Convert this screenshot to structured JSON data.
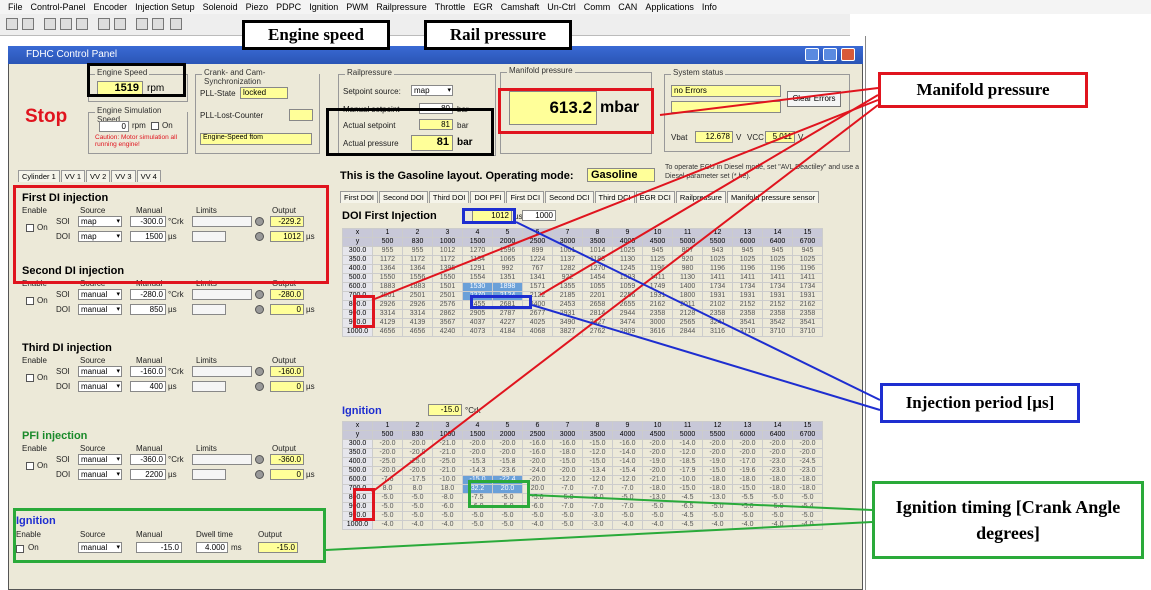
{
  "menu": [
    "File",
    "Control-Panel",
    "Encoder",
    "Injection Setup",
    "Solenoid",
    "Piezo",
    "PDPC",
    "Ignition",
    "PWM",
    "Railpressure",
    "Throttle",
    "EGR",
    "Camshaft",
    "Un-Ctrl",
    "Comm",
    "CAN",
    "Applications",
    "Info"
  ],
  "window": {
    "title": "FDHC Control Panel"
  },
  "engine_speed": {
    "group": "Engine Speed",
    "value": "1519",
    "unit": "rpm"
  },
  "sim": {
    "group": "Engine Simulation Speed",
    "value": "0",
    "unit": "rpm",
    "on": "On",
    "caution": "Caution: Motor simulation all running engine!"
  },
  "stop": "Stop",
  "crank": {
    "group": "Crank- and Cam-Synchronization",
    "pll_state_label": "PLL-State",
    "pll_state": "locked",
    "pll_lost_label": "PLL-Lost-Counter",
    "sync": "Engine-Speed ftom"
  },
  "rail": {
    "group": "Railpressure",
    "setpoint_source_label": "Setpoint source:",
    "setpoint_source": "map",
    "manual_label": "Manual setpoint",
    "manual": "80",
    "actual_setpoint_label": "Actual setpoint",
    "actual_setpoint": "81",
    "actual_pressure_label": "Actual pressure",
    "actual_pressure": "81",
    "unit": "bar"
  },
  "manifold": {
    "group": "Manifold pressure",
    "value": "613.2",
    "unit": "mbar"
  },
  "system": {
    "group": "System status",
    "status": "no Errors",
    "clear": "Clear Errors",
    "vbat_label": "Vbat",
    "vbat": "12.678",
    "vbat_unit": "V",
    "vcc_label": "VCC",
    "vcc": "5.011",
    "vcc_unit": "V"
  },
  "cyl_tabs": [
    "Cylinder 1",
    "VV 1",
    "VV 2",
    "VV 3",
    "VV 4"
  ],
  "layout_text": "This is the Gasoline layout. Operating mode:",
  "mode": "Gasoline",
  "diesel_note": "To operate ECU in Diesel mode, set \"AVL Deactiley\" and use a Diesel parameter set (*.he).",
  "map_tabs": [
    "First DOI",
    "Second DOI",
    "Third DOI",
    "DOI PFI",
    "First DCI",
    "Second DCI",
    "Third DCI",
    "EGR DCI",
    "Railpressure",
    "Manifold pressure sensor"
  ],
  "injections": [
    {
      "title": "First DI injection",
      "soi_src": "map",
      "doi_src": "map",
      "soi_manual": "-300.0",
      "soi_unit": "°Crk",
      "doi_manual": "1500",
      "doi_unit": "µs",
      "out_soi": "-229.2",
      "out_doi": "1012"
    },
    {
      "title": "Second DI injection",
      "soi_src": "manual",
      "doi_src": "manual",
      "soi_manual": "-280.0",
      "soi_unit": "°Crk",
      "doi_manual": "850",
      "doi_unit": "µs",
      "out_soi": "-280.0",
      "out_doi": "0"
    },
    {
      "title": "Third DI injection",
      "soi_src": "manual",
      "doi_src": "manual",
      "soi_manual": "-160.0",
      "soi_unit": "°Crk",
      "doi_manual": "400",
      "doi_unit": "µs",
      "out_soi": "-160.0",
      "out_doi": "0"
    },
    {
      "title": "PFI injection",
      "soi_src": "manual",
      "doi_src": "manual",
      "soi_manual": "-360.0",
      "soi_unit": "°Crk",
      "doi_manual": "2200",
      "doi_unit": "µs",
      "out_soi": "-360.0",
      "out_doi": "0"
    }
  ],
  "col_labels": {
    "enable": "Enable",
    "source": "Source",
    "manual": "Manual",
    "limits": "Limits",
    "output": "Output",
    "on": "On",
    "soi": "SOI",
    "doi": "DOI"
  },
  "ignition": {
    "title": "Ignition",
    "source": "manual",
    "manual": "-15.0",
    "dwell": "4.000",
    "dwell_unit": "ms",
    "output": "-15.0",
    "labels": {
      "dwell": "Dwell time"
    }
  },
  "doi_map": {
    "title": "DOI First Injection",
    "value": "1012",
    "unit": "µs",
    "val2": "1000",
    "cols": [
      "500",
      "830",
      "1000",
      "1500",
      "2000",
      "2500",
      "3000",
      "3500",
      "4000",
      "4500",
      "5000",
      "5500",
      "6000",
      "6400",
      "6700"
    ],
    "rows": [
      "300.0",
      "350.0",
      "400.0",
      "500.0",
      "600.0",
      "700.0",
      "800.0",
      "900.0",
      "970.0",
      "1000.0"
    ],
    "data": [
      [
        "955",
        "955",
        "1012",
        "1270",
        "1596",
        "899",
        "1001",
        "1014",
        "1025",
        "945",
        "807",
        "943",
        "945",
        "945",
        "945"
      ],
      [
        "1172",
        "1172",
        "1172",
        "1134",
        "1065",
        "1224",
        "1137",
        "1183",
        "1130",
        "1125",
        "920",
        "1025",
        "1025",
        "1025",
        "1025"
      ],
      [
        "1364",
        "1364",
        "1395",
        "1291",
        "992",
        "767",
        "1282",
        "1270",
        "1245",
        "1196",
        "980",
        "1196",
        "1196",
        "1196",
        "1196"
      ],
      [
        "1550",
        "1556",
        "1550",
        "1554",
        "1351",
        "1341",
        "922",
        "1454",
        "1503",
        "1411",
        "1130",
        "1411",
        "1411",
        "1411",
        "1411"
      ],
      [
        "1883",
        "1883",
        "1501",
        "1530",
        "1898",
        "1571",
        "1355",
        "1055",
        "1059",
        "1749",
        "1400",
        "1734",
        "1734",
        "1734",
        "1734"
      ],
      [
        "2501",
        "2501",
        "2501",
        "2270",
        "2124",
        "2122",
        "2185",
        "2201",
        "2256",
        "1931",
        "1800",
        "1931",
        "1931",
        "1931",
        "1931"
      ],
      [
        "2926",
        "2926",
        "2576",
        "2455",
        "2681",
        "2400",
        "2453",
        "2658",
        "2655",
        "2162",
        "2011",
        "2102",
        "2152",
        "2152",
        "2162"
      ],
      [
        "3314",
        "3314",
        "2862",
        "2905",
        "2787",
        "2677",
        "2931",
        "2814",
        "2944",
        "2358",
        "2128",
        "2358",
        "2358",
        "2358",
        "2358"
      ],
      [
        "4129",
        "4139",
        "3567",
        "4037",
        "4227",
        "4025",
        "3490",
        "3427",
        "3474",
        "3000",
        "2565",
        "3241",
        "3541",
        "3542",
        "3541"
      ],
      [
        "4656",
        "4656",
        "4240",
        "4073",
        "4184",
        "4068",
        "3827",
        "2762",
        "2809",
        "3616",
        "2844",
        "3116",
        "3710",
        "3710",
        "3710"
      ]
    ]
  },
  "ign_map": {
    "title": "Ignition",
    "value": "-15.0",
    "unit": "°Crk",
    "cols": [
      "500",
      "830",
      "1000",
      "1500",
      "2000",
      "2500",
      "3000",
      "3500",
      "4000",
      "4500",
      "5000",
      "5500",
      "6000",
      "6400",
      "6700"
    ],
    "rows": [
      "300.0",
      "350.0",
      "400.0",
      "500.0",
      "600.0",
      "700.0",
      "800.0",
      "900.0",
      "970.0",
      "1000.0"
    ],
    "data": [
      [
        "-20.0",
        "-20.0",
        "-21.0",
        "-20.0",
        "-20.0",
        "-16.0",
        "-16.0",
        "-15.0",
        "-16.0",
        "-20.0",
        "-14.0",
        "-20.0",
        "-20.0",
        "-20.0",
        "-20.0"
      ],
      [
        "-20.0",
        "-20.0",
        "-21.0",
        "-20.0",
        "-20.0",
        "-16.0",
        "-18.0",
        "-12.0",
        "-14.0",
        "-20.0",
        "-12.0",
        "-20.0",
        "-20.0",
        "-20.0",
        "-20.0"
      ],
      [
        "-25.0",
        "-25.0",
        "-25.0",
        "-15.3",
        "-15.8",
        "-20.0",
        "-15.0",
        "-15.0",
        "-14.0",
        "-19.0",
        "-18.5",
        "-19.0",
        "-17.0",
        "-23.0",
        "-24.5"
      ],
      [
        "-20.0",
        "-20.0",
        "-21.0",
        "-14.3",
        "-23.6",
        "-24.0",
        "-20.0",
        "-13.4",
        "-15.4",
        "-20.0",
        "-17.9",
        "-15.0",
        "-19.6",
        "-23.0",
        "-23.0"
      ],
      [
        "-7.6",
        "-17.5",
        "-10.0",
        "-15.0",
        "-22.4",
        "-20.0",
        "-12.0",
        "-12.0",
        "-12.0",
        "-21.0",
        "-10.0",
        "-18.0",
        "-18.0",
        "-18.0",
        "-18.0"
      ],
      [
        "8.0",
        "8.0",
        "18.0",
        "32.2",
        "20.0",
        "20.0",
        "-7.0",
        "-7.0",
        "-7.0",
        "-18.0",
        "-15.0",
        "-18.0",
        "-15.0",
        "-18.0",
        "-18.0"
      ],
      [
        "-5.0",
        "-5.0",
        "-8.0",
        "-7.5",
        "-5.0",
        "-5.0",
        "-5.0",
        "-5.0",
        "-5.0",
        "-13.0",
        "-4.5",
        "-13.0",
        "-5.5",
        "-5.0",
        "-5.0"
      ],
      [
        "-5.0",
        "-5.0",
        "-6.0",
        "-6.0",
        "-5.0",
        "-6.0",
        "-7.0",
        "-7.0",
        "-7.0",
        "-5.0",
        "-6.5",
        "-5.0",
        "-5.0",
        "-5.0",
        "-5.4"
      ],
      [
        "-5.0",
        "-5.0",
        "-5.0",
        "-5.0",
        "-5.0",
        "-5.0",
        "-5.0",
        "-3.0",
        "-5.0",
        "-5.0",
        "-4.5",
        "-5.0",
        "-5.0",
        "-5.0",
        "-5.0"
      ],
      [
        "-4.0",
        "-4.0",
        "-4.0",
        "-5.0",
        "-5.0",
        "-4.0",
        "-5.0",
        "-3.0",
        "-4.0",
        "-4.0",
        "-4.5",
        "-4.0",
        "-4.0",
        "-4.0",
        "-4.0"
      ]
    ]
  },
  "callouts": {
    "engine_speed": "Engine speed",
    "rail_pressure": "Rail pressure",
    "manifold": "Manifold pressure",
    "injection": "Injection period [µs]",
    "ignition": "Ignition timing [Crank Angle degrees]"
  },
  "colors": {
    "callout_black": "#000000",
    "callout_red": "#e0141e",
    "callout_blue": "#1e2ed0",
    "callout_green": "#2aaa3a"
  }
}
